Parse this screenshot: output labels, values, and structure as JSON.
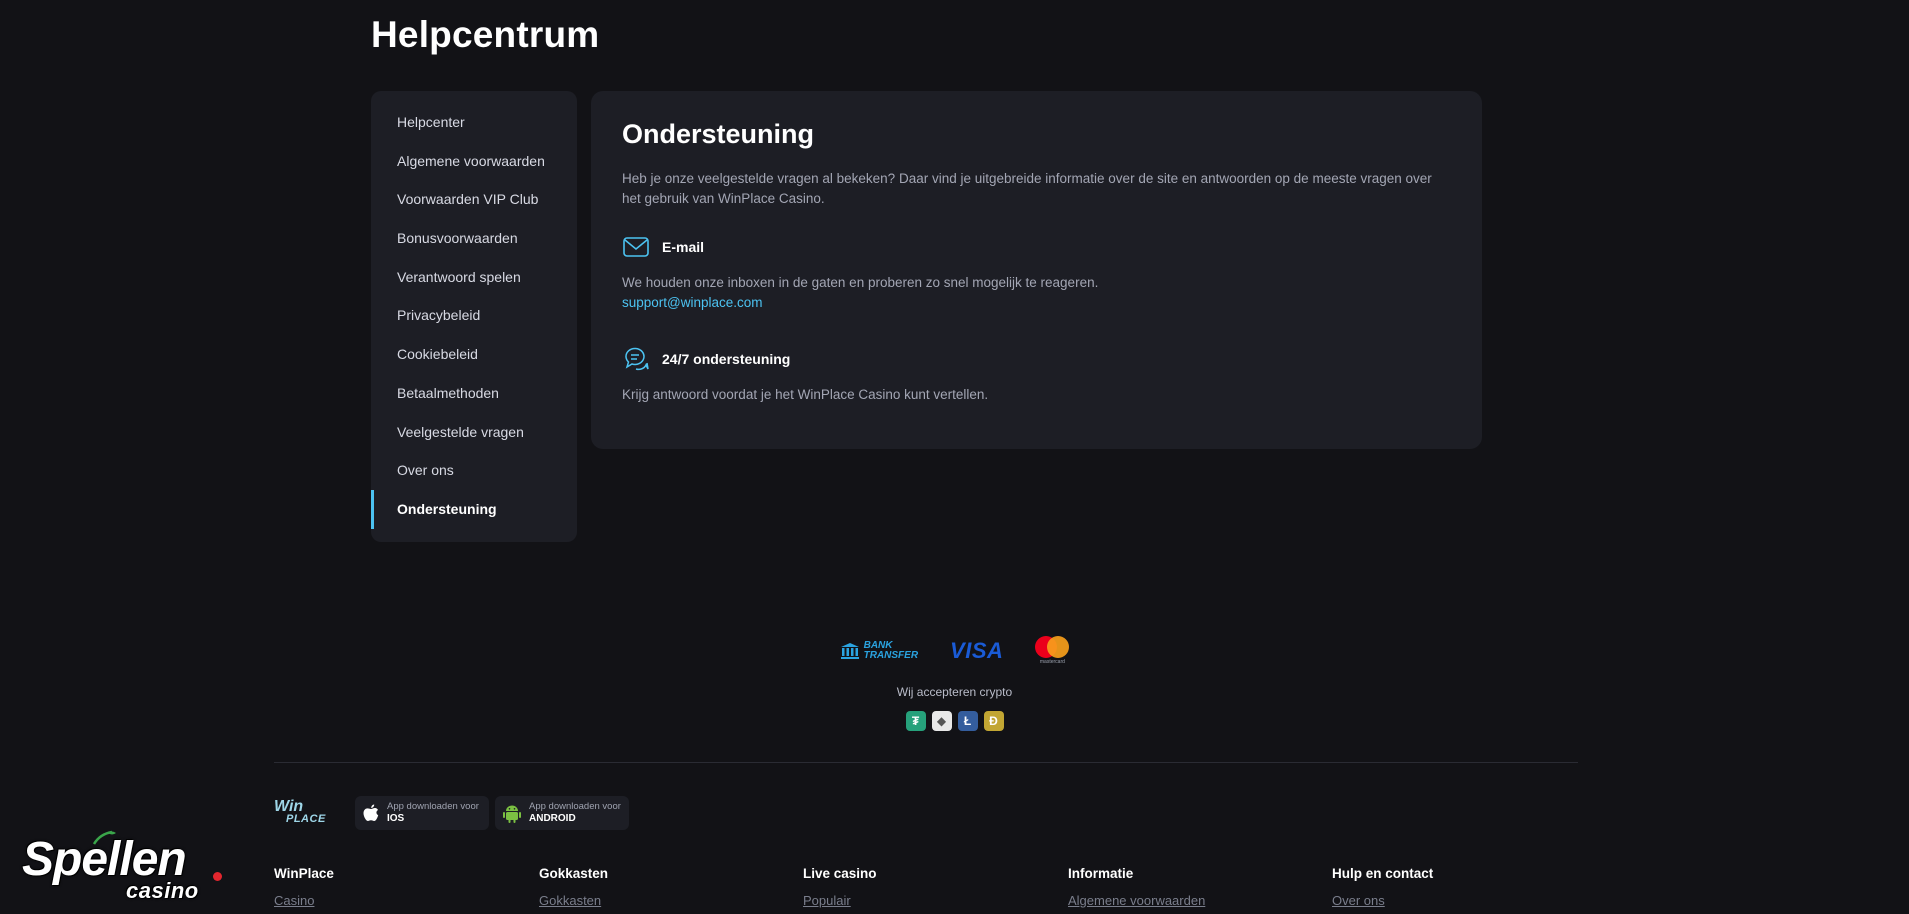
{
  "page": {
    "title": "Helpcentrum"
  },
  "sidebar": {
    "items": [
      {
        "label": "Helpcenter"
      },
      {
        "label": "Algemene voorwaarden"
      },
      {
        "label": "Voorwaarden VIP Club"
      },
      {
        "label": "Bonusvoorwaarden"
      },
      {
        "label": "Verantwoord spelen"
      },
      {
        "label": "Privacybeleid"
      },
      {
        "label": "Cookiebeleid"
      },
      {
        "label": "Betaalmethoden"
      },
      {
        "label": "Veelgestelde vragen"
      },
      {
        "label": "Over ons"
      },
      {
        "label": "Ondersteuning"
      }
    ],
    "active_index": 10
  },
  "support": {
    "title": "Ondersteuning",
    "intro": "Heb je onze veelgestelde vragen al bekeken? Daar vind je uitgebreide informatie over de site en antwoorden op de meeste vragen over het gebruik van WinPlace Casino.",
    "email": {
      "icon": "mail-icon",
      "label": "E-mail",
      "text": "We houden onze inboxen in de gaten en proberen zo snel mogelijk te reageren.",
      "address": "support@winplace.com"
    },
    "chat": {
      "icon": "chat-icon",
      "label": "24/7 ondersteuning",
      "text": "Krijg antwoord voordat je het WinPlace Casino kunt vertellen."
    }
  },
  "payments": {
    "bank_line1": "BANK",
    "bank_line2": "TRANSFER",
    "visa": "VISA",
    "mastercard_text": "mastercard",
    "crypto_label": "Wij accepteren crypto",
    "crypto": [
      {
        "symbol": "₮",
        "color": "#26a17b",
        "icon": "tether-icon"
      },
      {
        "symbol": "◆",
        "color": "#e8e8e8",
        "icon": "ethereum-icon"
      },
      {
        "symbol": "Ł",
        "color": "#345d9d",
        "icon": "litecoin-icon"
      },
      {
        "symbol": "Ð",
        "color": "#c2a633",
        "icon": "dogecoin-icon"
      }
    ]
  },
  "footer": {
    "logo_line1": "Win",
    "logo_line2": "PLACE",
    "app_ios_small": "App downloaden voor",
    "app_ios_big": "IOS",
    "app_android_small": "App downloaden voor",
    "app_android_big": "ANDROID",
    "columns": [
      {
        "head": "WinPlace",
        "first": "Casino"
      },
      {
        "head": "Gokkasten",
        "first": "Gokkasten"
      },
      {
        "head": "Live casino",
        "first": "Populair"
      },
      {
        "head": "Informatie",
        "first": "Algemene voorwaarden"
      },
      {
        "head": "Hulp en contact",
        "first": "Over ons"
      }
    ]
  },
  "watermark": {
    "main": "Spellen",
    "sub": "casino"
  },
  "colors": {
    "accent": "#4cc3f2",
    "panel": "#1d1e25",
    "background": "#121216"
  }
}
